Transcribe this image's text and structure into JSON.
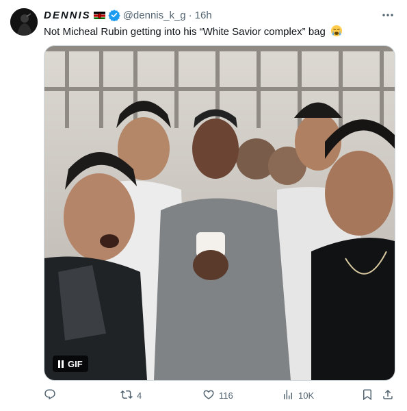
{
  "author": {
    "display_name": "DENNIS",
    "flag_icon": "kenya-flag-icon",
    "verified_icon": "verified-badge-icon",
    "handle": "@dennis_k_g",
    "separator": "·",
    "time": "16h"
  },
  "tweet": {
    "text": "Not Micheal Rubin getting into his “White Savior complex” bag",
    "emoji": "loudly-crying-face"
  },
  "media": {
    "type": "gif",
    "badge_label": "GIF",
    "pause_icon": "pause-icon"
  },
  "actions": {
    "reply": {
      "icon": "reply-icon",
      "count": ""
    },
    "repost": {
      "icon": "repost-icon",
      "count": "4"
    },
    "like": {
      "icon": "heart-icon",
      "count": "116"
    },
    "views": {
      "icon": "views-chart-icon",
      "count": "10K"
    },
    "bookmark": {
      "icon": "bookmark-icon"
    },
    "share": {
      "icon": "share-icon"
    }
  },
  "colors": {
    "text": "#0f1419",
    "secondary": "#536471",
    "verified": "#1d9bf0"
  }
}
